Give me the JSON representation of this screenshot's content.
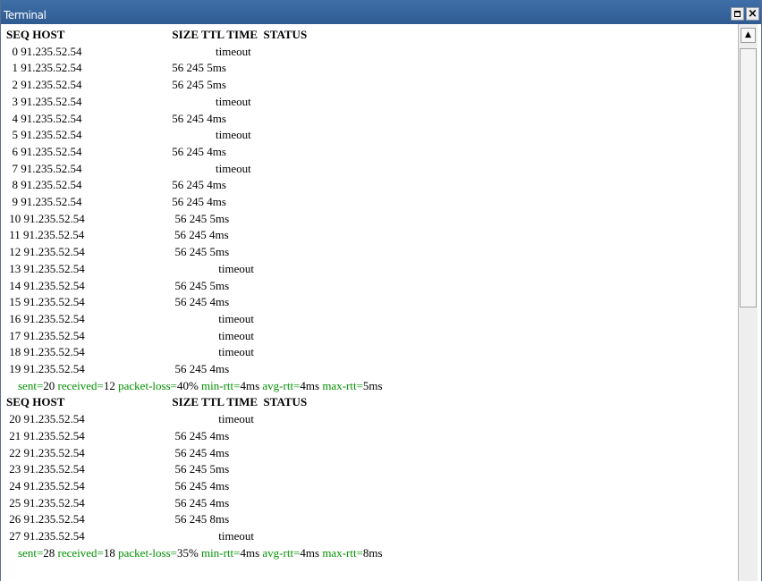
{
  "window": {
    "title": "Terminal"
  },
  "icons": {
    "maximize": "maximize-icon",
    "close": "close-icon",
    "scroll_up": "arrow-up-icon"
  },
  "colors": {
    "titlebar": "#2f5b92",
    "summary_key": "#009000"
  },
  "terminal": {
    "header": "SEQ HOST                                     SIZE TTL TIME  STATUS",
    "lines": [
      {
        "text": "  0 91.235.52.54                                              timeout"
      },
      {
        "text": "  1 91.235.52.54                               56 245 5ms"
      },
      {
        "text": "  2 91.235.52.54                               56 245 5ms"
      },
      {
        "text": "  3 91.235.52.54                                              timeout"
      },
      {
        "text": "  4 91.235.52.54                               56 245 4ms"
      },
      {
        "text": "  5 91.235.52.54                                              timeout"
      },
      {
        "text": "  6 91.235.52.54                               56 245 4ms"
      },
      {
        "text": "  7 91.235.52.54                                              timeout"
      },
      {
        "text": "  8 91.235.52.54                               56 245 4ms"
      },
      {
        "text": "  9 91.235.52.54                               56 245 4ms"
      },
      {
        "text": " 10 91.235.52.54                               56 245 5ms"
      },
      {
        "text": " 11 91.235.52.54                               56 245 4ms"
      },
      {
        "text": " 12 91.235.52.54                               56 245 5ms"
      },
      {
        "text": " 13 91.235.52.54                                              timeout"
      },
      {
        "text": " 14 91.235.52.54                               56 245 5ms"
      },
      {
        "text": " 15 91.235.52.54                               56 245 4ms"
      },
      {
        "text": " 16 91.235.52.54                                              timeout"
      },
      {
        "text": " 17 91.235.52.54                                              timeout"
      },
      {
        "text": " 18 91.235.52.54                                              timeout"
      },
      {
        "text": " 19 91.235.52.54                               56 245 4ms"
      },
      {
        "summary": [
          {
            "k": "    sent=",
            "v": "20"
          },
          {
            "k": " received=",
            "v": "12"
          },
          {
            "k": " packet-loss=",
            "v": "40%"
          },
          {
            "k": " min-rtt=",
            "v": "4ms"
          },
          {
            "k": " avg-rtt=",
            "v": "4ms"
          },
          {
            "k": " max-rtt=",
            "v": "5ms"
          }
        ]
      },
      {
        "header": "SEQ HOST                                     SIZE TTL TIME  STATUS"
      },
      {
        "text": " 20 91.235.52.54                                              timeout"
      },
      {
        "text": " 21 91.235.52.54                               56 245 4ms"
      },
      {
        "text": " 22 91.235.52.54                               56 245 4ms"
      },
      {
        "text": " 23 91.235.52.54                               56 245 5ms"
      },
      {
        "text": " 24 91.235.52.54                               56 245 4ms"
      },
      {
        "text": " 25 91.235.52.54                               56 245 4ms"
      },
      {
        "text": " 26 91.235.52.54                               56 245 8ms"
      },
      {
        "text": " 27 91.235.52.54                                              timeout"
      },
      {
        "summary": [
          {
            "k": "    sent=",
            "v": "28"
          },
          {
            "k": " received=",
            "v": "18"
          },
          {
            "k": " packet-loss=",
            "v": "35%"
          },
          {
            "k": " min-rtt=",
            "v": "4ms"
          },
          {
            "k": " avg-rtt=",
            "v": "4ms"
          },
          {
            "k": " max-rtt=",
            "v": "8ms"
          }
        ]
      }
    ]
  }
}
